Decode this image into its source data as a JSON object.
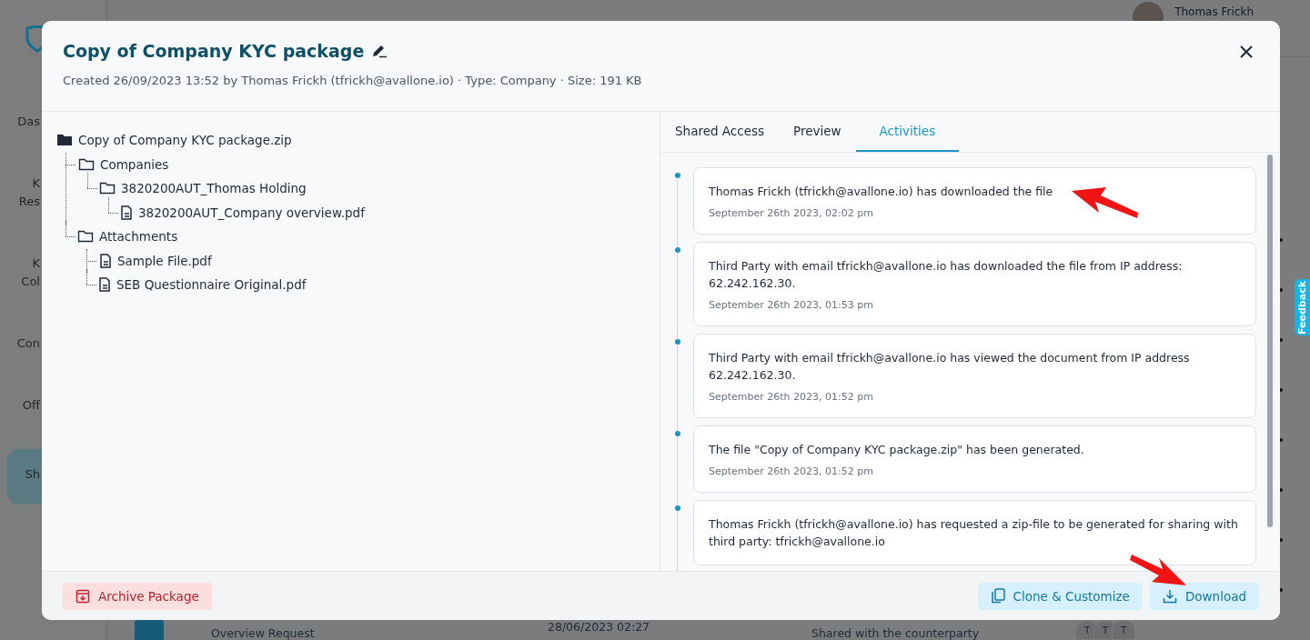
{
  "background": {
    "user_name": "Thomas Frickh",
    "sidebar": [
      {
        "lines": [
          "Das"
        ],
        "selected": false
      },
      {
        "lines": [
          "K",
          "Res"
        ],
        "selected": false
      },
      {
        "lines": [
          "K",
          "Col"
        ],
        "selected": false
      },
      {
        "lines": [
          "Con"
        ],
        "selected": false
      },
      {
        "lines": [
          "Off"
        ],
        "selected": false
      },
      {
        "lines": [
          "Sh"
        ],
        "selected": true
      }
    ],
    "bottom_row": {
      "name": "Overview Request",
      "date": "28/06/2023 02:27",
      "status": "Shared with the counterparty",
      "avatars": [
        "T",
        "T",
        "T"
      ]
    },
    "feedback_tab": "Feedback"
  },
  "dialog": {
    "title": "Copy of Company KYC package",
    "subtitle": "Created 26/09/2023 13:52 by Thomas Frickh (tfrickh@avallone.io) · Type: Company · Size: 191 KB",
    "tree": [
      {
        "kind": "zip",
        "name": "Copy of Company KYC package.zip",
        "children": [
          {
            "kind": "folder",
            "name": "Companies",
            "children": [
              {
                "kind": "folder",
                "name": "3820200AUT_Thomas Holding",
                "children": [
                  {
                    "kind": "file",
                    "name": "3820200AUT_Company overview.pdf"
                  }
                ]
              }
            ]
          },
          {
            "kind": "folder",
            "name": "Attachments",
            "children": [
              {
                "kind": "file",
                "name": "Sample File.pdf"
              },
              {
                "kind": "file",
                "name": "SEB Questionnaire Original.pdf"
              }
            ]
          }
        ]
      }
    ],
    "tabs": [
      {
        "label": "Shared Access",
        "selected": false
      },
      {
        "label": "Preview",
        "selected": false
      },
      {
        "label": "Activities",
        "selected": true
      }
    ],
    "activities": [
      {
        "text": "Thomas Frickh (tfrickh@avallone.io) has downloaded the file",
        "time": "September 26th 2023, 02:02 pm"
      },
      {
        "text": "Third Party with email tfrickh@avallone.io has downloaded the file from IP address: 62.242.162.30.",
        "time": "September 26th 2023, 01:53 pm"
      },
      {
        "text": "Third Party with email tfrickh@avallone.io has viewed the document from IP address 62.242.162.30.",
        "time": "September 26th 2023, 01:52 pm"
      },
      {
        "text": "The file \"Copy of Company KYC package.zip\" has been generated.",
        "time": "September 26th 2023, 01:52 pm"
      },
      {
        "text": "Thomas Frickh (tfrickh@avallone.io) has requested a zip-file to be generated for sharing with third party: tfrickh@avallone.io"
      }
    ],
    "buttons": [
      {
        "kind": "archive",
        "label": "Archive Package"
      },
      {
        "kind": "clone",
        "label": "Clone & Customize"
      },
      {
        "kind": "download",
        "label": "Download"
      }
    ]
  }
}
